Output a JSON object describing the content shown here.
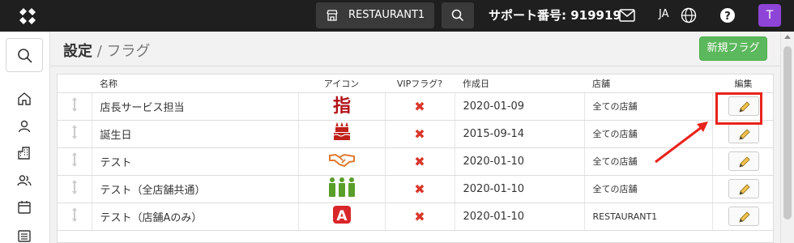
{
  "header": {
    "store_name": "RESTAURANT1",
    "support_text": "サポート番号: 919919",
    "lang": "JA",
    "avatar_initial": "T"
  },
  "page": {
    "title": "設定",
    "title_separator": " / ",
    "subtitle": "フラグ",
    "new_button": "新規フラグ"
  },
  "table": {
    "columns": [
      "名称",
      "アイコン",
      "VIPフラグ?",
      "作成日",
      "店舗",
      "編集"
    ],
    "rows": [
      {
        "name": "店長サービス担当",
        "icon": "finger-kanji-icon",
        "vip": "✖",
        "date": "2020-01-09",
        "store": "全ての店舗"
      },
      {
        "name": "誕生日",
        "icon": "birthday-cake-icon",
        "vip": "✖",
        "date": "2015-09-14",
        "store": "全ての店舗"
      },
      {
        "name": "テスト",
        "icon": "handshake-icon",
        "vip": "✖",
        "date": "2020-01-10",
        "store": "全ての店舗"
      },
      {
        "name": "テスト（全店舗共通）",
        "icon": "group-people-icon",
        "vip": "✖",
        "date": "2020-01-10",
        "store": "全ての店舗"
      },
      {
        "name": "テスト（店舗Aのみ）",
        "icon": "letter-a-icon",
        "vip": "✖",
        "date": "2020-01-10",
        "store": "RESTAURANT1"
      }
    ]
  },
  "icon_glyphs": {
    "finger": "指",
    "letter_a": "A"
  },
  "colors": {
    "accent_green": "#5cb85c",
    "highlight_red": "#e8231c",
    "avatar_purple": "#8e44d6",
    "x_red": "#d9362b"
  }
}
